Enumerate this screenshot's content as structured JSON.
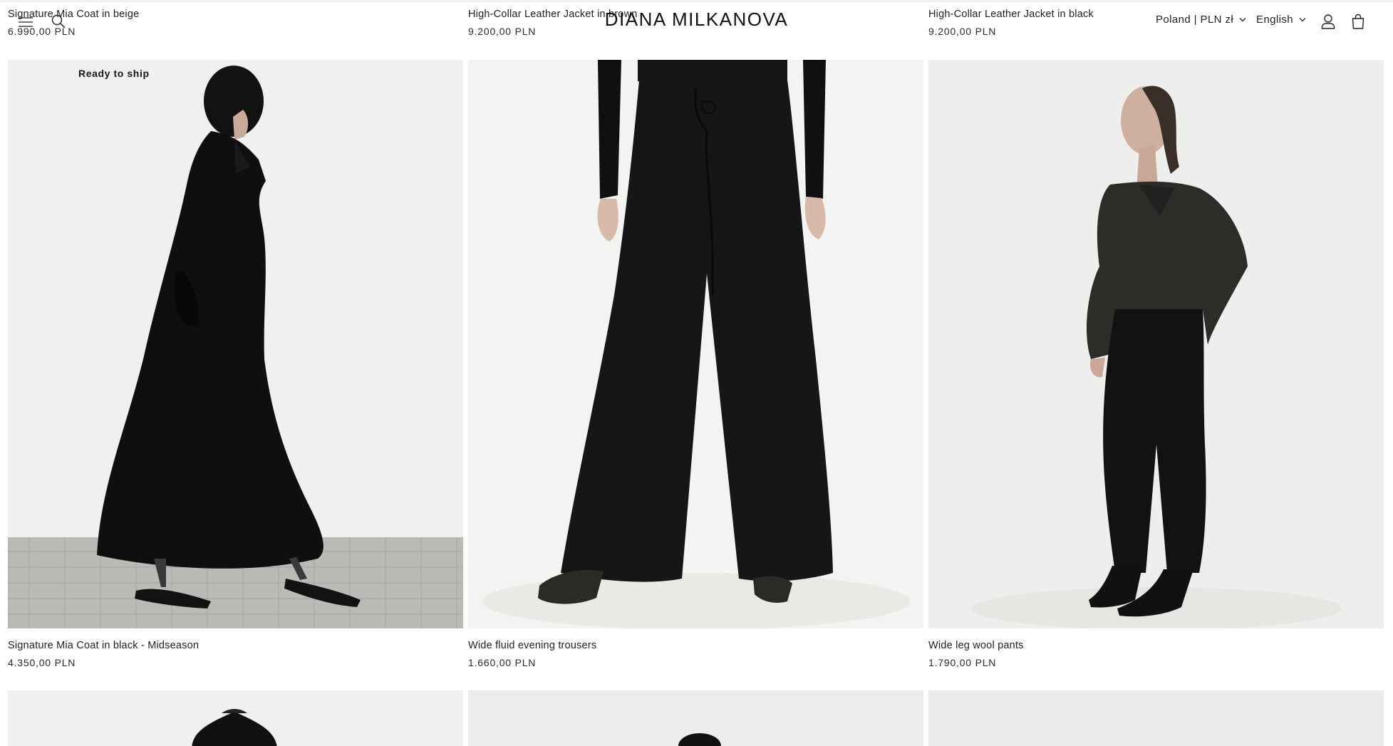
{
  "header": {
    "brand": "DIANA MILKANOVA",
    "country_selector": "Poland | PLN zł",
    "language_selector": "English",
    "icons": [
      "hamburger-menu-icon",
      "search-icon",
      "account-icon",
      "shopping-bag-icon"
    ]
  },
  "previous_row": [
    {
      "title": "Signature Mia Coat in beige",
      "price": "6.990,00 PLN"
    },
    {
      "title": "High-Collar Leather Jacket in brown",
      "price": "9.200,00 PLN"
    },
    {
      "title": "High-Collar Leather Jacket in black",
      "price": "9.200,00 PLN"
    }
  ],
  "products": [
    {
      "title": "Signature Mia Coat in black - Midseason",
      "price": "4.350,00 PLN",
      "badge": "Ready to ship"
    },
    {
      "title": "Wide fluid evening trousers",
      "price": "1.660,00 PLN"
    },
    {
      "title": "Wide leg wool pants",
      "price": "1.790,00 PLN"
    }
  ],
  "colors": {
    "page_background": "#ffffff",
    "text": "#1a1a1a",
    "garment": "#111111",
    "photo_background": "#eeeeec"
  }
}
